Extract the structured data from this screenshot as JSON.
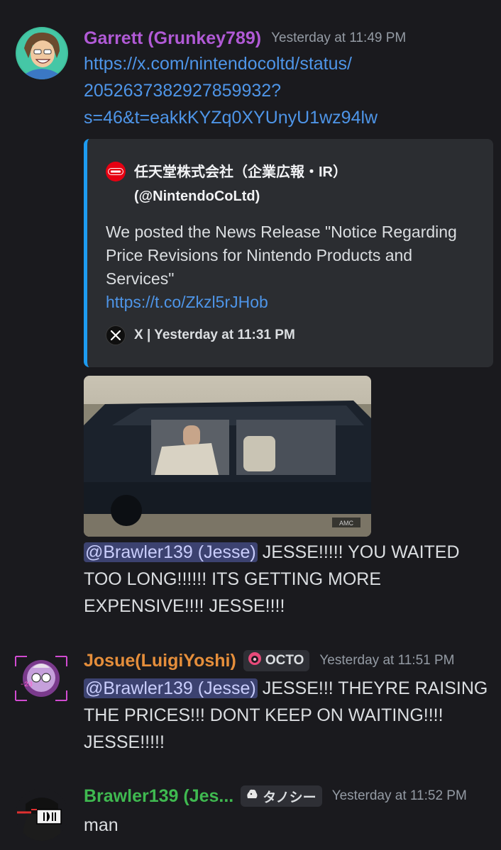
{
  "messages": [
    {
      "username": "Garrett (Grunkey789)",
      "username_color": "#b15ad6",
      "timestamp": "Yesterday at 11:49 PM",
      "link_lines": [
        "https://x.com/nintendocoltd/status/",
        "2052637382927859932?",
        "s=46&t=eakkKYZq0XYUnyU1wz94lw"
      ],
      "embed": {
        "author_line1": "任天堂株式会社（企業広報・IR）",
        "author_line2": "(@NintendoCoLtd)",
        "description": "We posted the News Release \"Notice Regarding Price Revisions for Nintendo Products and Services\"",
        "link": "https://t.co/Zkzl5rJHob",
        "footer": "X | Yesterday at 11:31 PM",
        "accent_color": "#1d9bf0"
      },
      "gif_watermark": "AMC",
      "mention": "@Brawler139 (Jesse)",
      "text": " JESSE!!!!! YOU WAITED TOO LONG!!!!!! ITS GETTING MORE EXPENSIVE!!!! JESSE!!!!"
    },
    {
      "username": "Josue(LuigiYoshi)",
      "username_color": "#e58e3b",
      "tag": "OCTO",
      "timestamp": "Yesterday at 11:51 PM",
      "mention": "@Brawler139 (Jesse)",
      "text": " JESSE!!! THEYRE RAISING THE PRICES!!! DONT KEEP ON WAITING!!!! JESSE!!!!!"
    },
    {
      "username": "Brawler139 (Jes...",
      "username_color": "#3fb950",
      "tag": "タノシー",
      "timestamp": "Yesterday at 11:52 PM",
      "text": "man"
    }
  ]
}
